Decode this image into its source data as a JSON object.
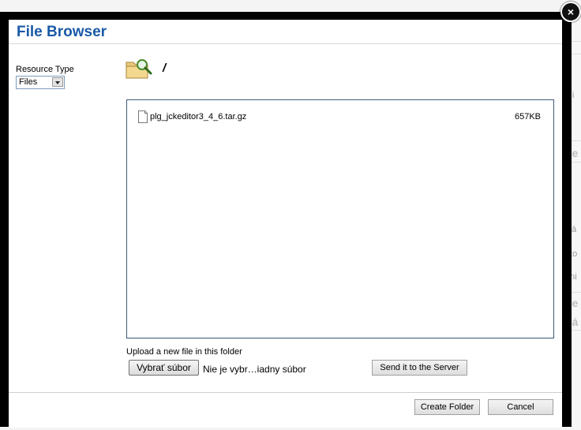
{
  "dialog": {
    "title": "File Browser",
    "close_symbol": "×"
  },
  "resource_type": {
    "label": "Resource Type",
    "selected": "Files"
  },
  "current_path": "/",
  "files": [
    {
      "name": "plg_jckeditor3_4_6.tar.gz",
      "size": "657KB",
      "icon": "file-icon"
    }
  ],
  "upload": {
    "label": "Upload a new file in this folder",
    "browse_label": "Vybrať súbor",
    "no_file_text": "Nie je vybr…iadny súbor",
    "send_label": "Send it to the Server"
  },
  "footer": {
    "create_folder_label": "Create Folder",
    "cancel_label": "Cancel"
  },
  "background_fragments": [
    "ne",
    "zíí",
    "ú",
    "Dá",
    "ato",
    "eni",
    "ne",
    "ná"
  ],
  "colors": {
    "title": "#1a5aa8",
    "frame": "#000000",
    "list_border": "#3c5a7a"
  }
}
